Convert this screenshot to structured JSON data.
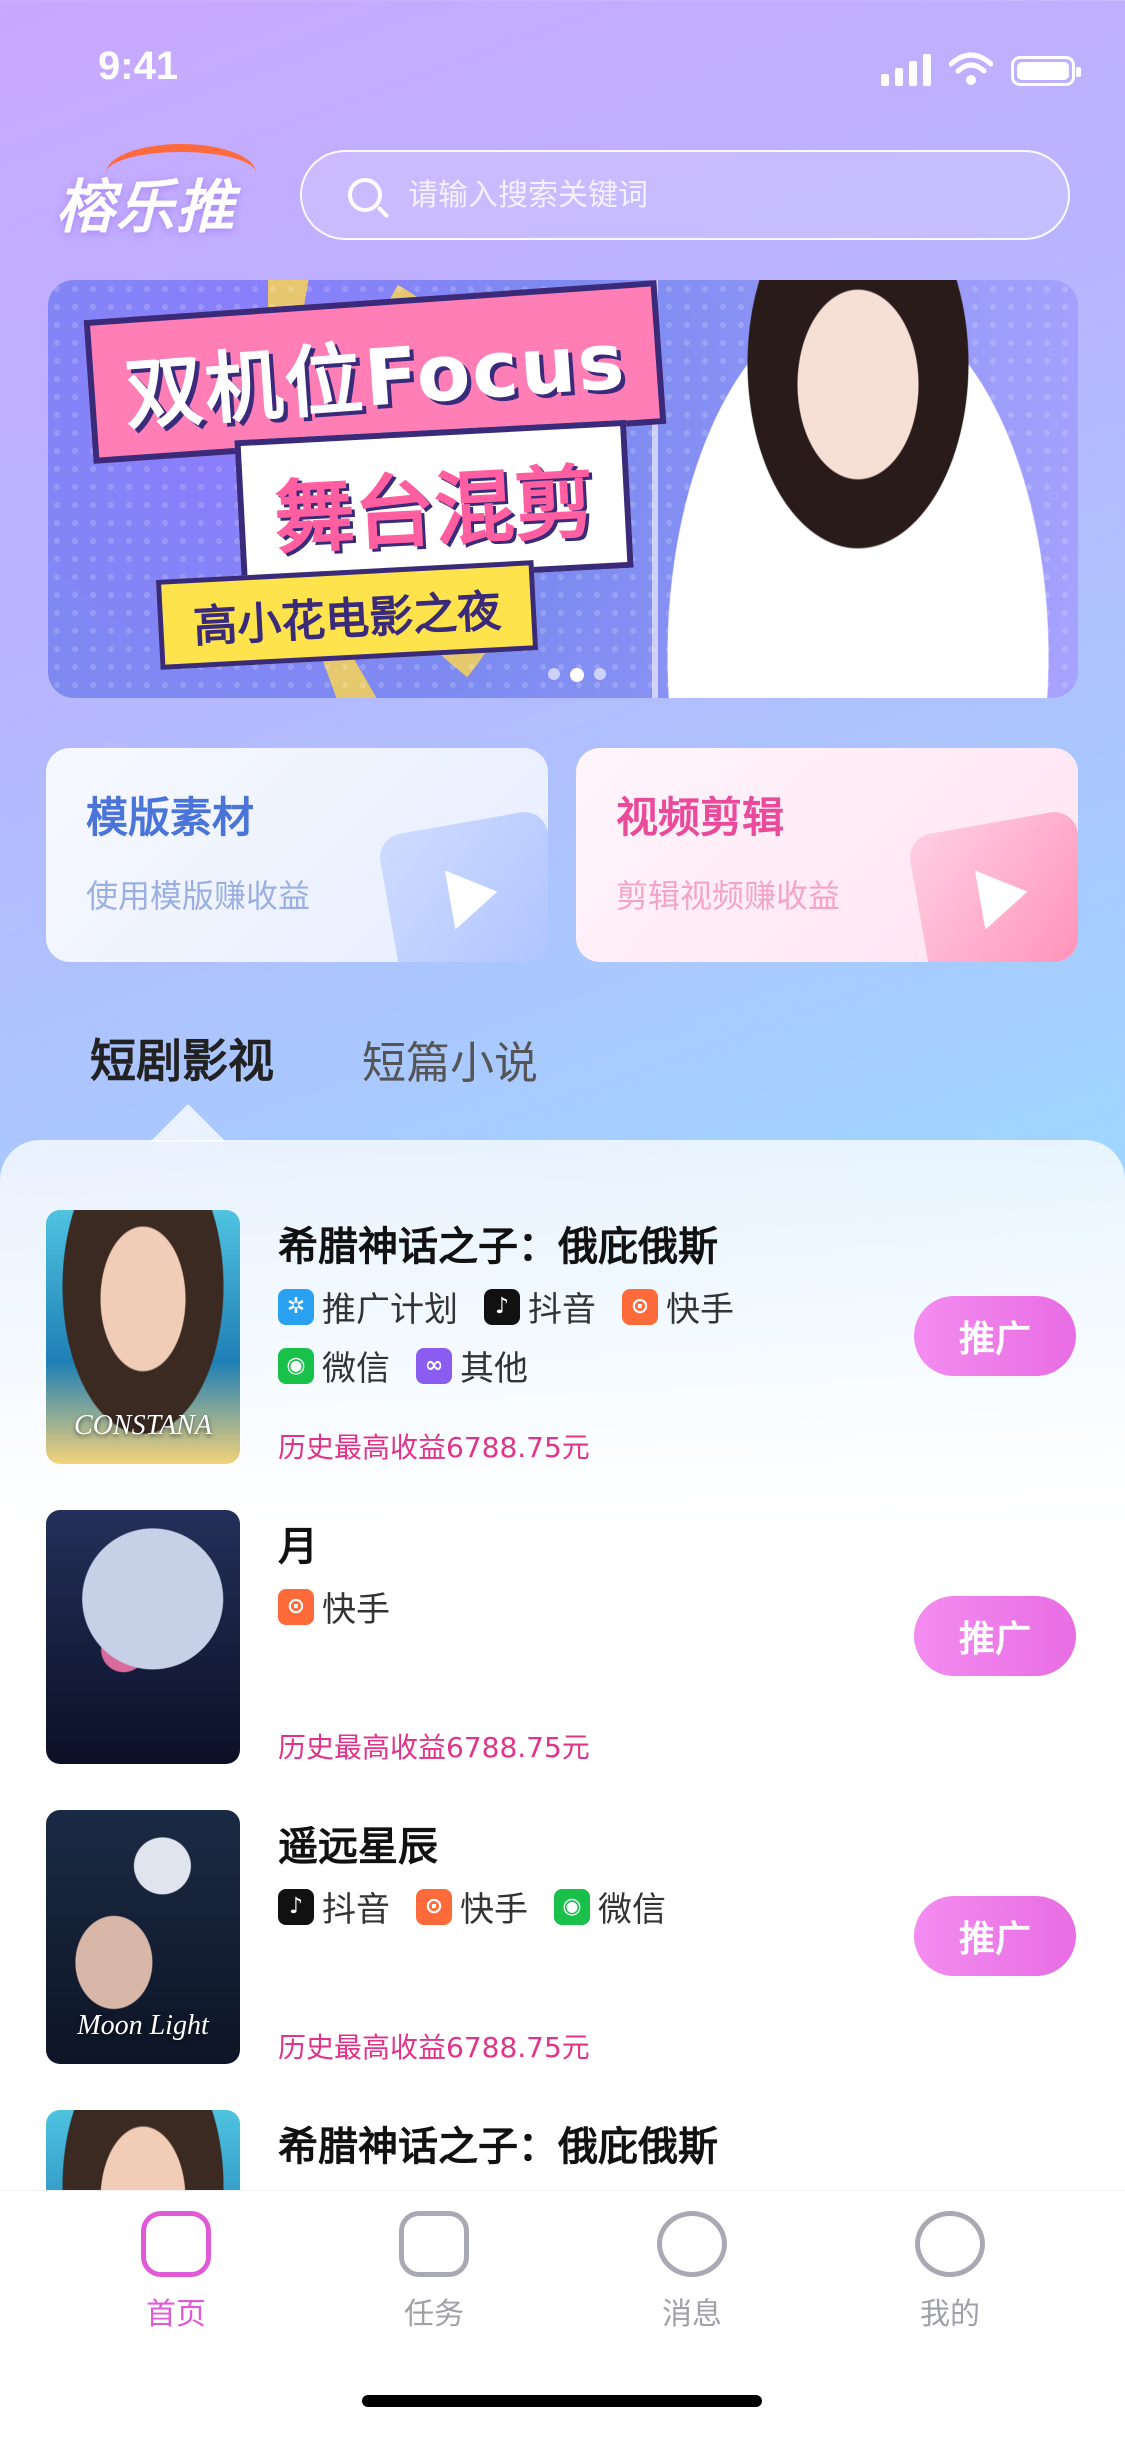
{
  "status_bar": {
    "time": "9:41"
  },
  "header": {
    "logo_text": "榕乐推",
    "search": {
      "placeholder": "请输入搜索关键词",
      "value": ""
    }
  },
  "banner": {
    "title_line1": "双机位Focus",
    "title_line2": "舞台混剪",
    "title_line3": "高小花电影之夜",
    "indicator_count": 3,
    "active_index": 1
  },
  "feature_cards": [
    {
      "title": "模版素材",
      "subtitle": "使用模版赚收益"
    },
    {
      "title": "视频剪辑",
      "subtitle": "剪辑视频赚收益"
    }
  ],
  "tabs": [
    {
      "label": "短剧影视",
      "active": true
    },
    {
      "label": "短篇小说",
      "active": false
    }
  ],
  "items": [
    {
      "title": "希腊神话之子：俄庇俄斯",
      "poster_text": "CONSTANA",
      "platforms": [
        "推广计划",
        "抖音",
        "快手",
        "微信",
        "其他"
      ],
      "earnings": "历史最高收益6788.75元",
      "button": "推广"
    },
    {
      "title": "月",
      "poster_text": "",
      "platforms": [
        "快手"
      ],
      "earnings": "历史最高收益6788.75元",
      "button": "推广"
    },
    {
      "title": "遥远星辰",
      "poster_text": "Moon Light",
      "platforms": [
        "抖音",
        "快手",
        "微信"
      ],
      "earnings": "历史最高收益6788.75元",
      "button": "推广"
    },
    {
      "title": "希腊神话之子：俄庇俄斯",
      "poster_text": "",
      "platforms": [],
      "earnings": "",
      "button": ""
    }
  ],
  "tabbar": [
    {
      "label": "首页",
      "icon": "home-icon",
      "active": true
    },
    {
      "label": "任务",
      "icon": "task-icon",
      "active": false
    },
    {
      "label": "消息",
      "icon": "message-icon",
      "active": false
    },
    {
      "label": "我的",
      "icon": "profile-icon",
      "active": false
    }
  ],
  "colors": {
    "accent_pink": "#e05ad6",
    "earnings_text": "#e2338a",
    "template_blue": "#4b74d9",
    "video_pink": "#e94b9a"
  }
}
